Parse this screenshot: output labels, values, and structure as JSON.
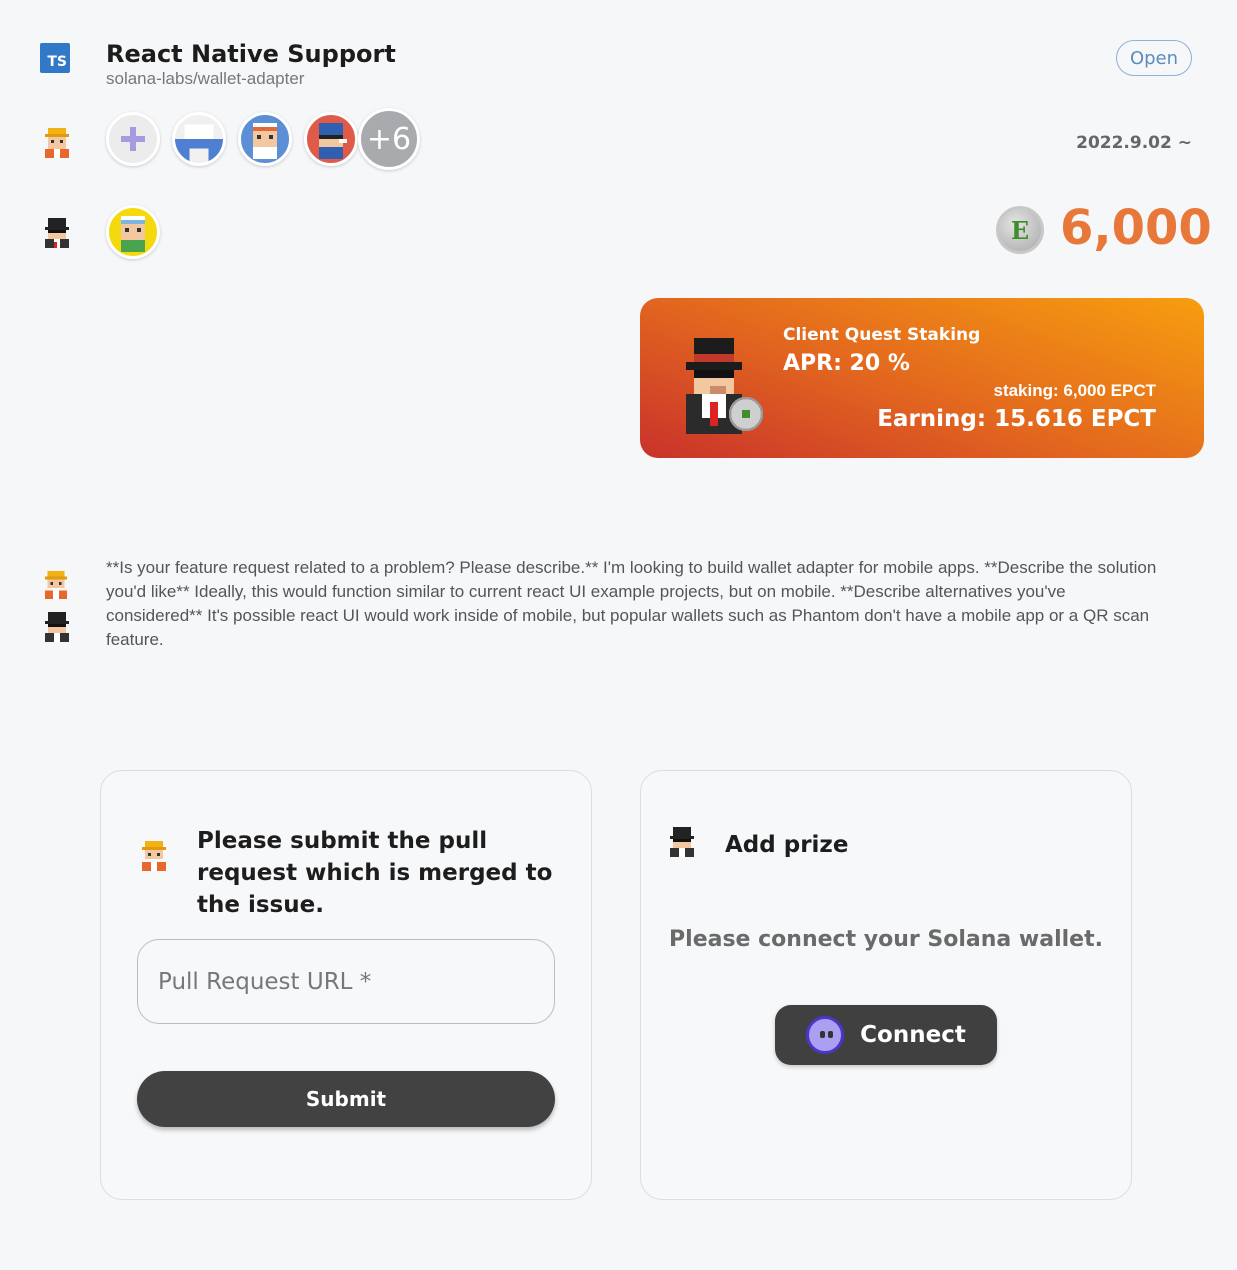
{
  "issue": {
    "language_badge": "TS",
    "title": "React Native Support",
    "repo": "solana-labs/wallet-adapter",
    "status": "Open"
  },
  "participants": {
    "more_count": "+6",
    "date": "2022.9.02 ~"
  },
  "prize": {
    "amount": "6,000",
    "token_letter": "E"
  },
  "staking": {
    "title": "Client Quest Staking",
    "apr": "APR: 20 %",
    "staking": "staking: 6,000 EPCT",
    "earning": "Earning: 15.616 EPCT"
  },
  "description": "**Is your feature request related to a problem? Please describe.** I'm looking to build wallet adapter for mobile apps. **Describe the solution you'd like** Ideally, this would function similar to current react UI example projects, but on mobile. **Describe alternatives you've considered** It's possible react UI would work inside of mobile, but popular wallets such as Phantom don't have a mobile app or a QR scan feature.",
  "submit_card": {
    "heading": "Please submit the pull request which is merged to the issue.",
    "input_placeholder": "Pull Request URL *",
    "submit_label": "Submit"
  },
  "prize_card": {
    "heading": "Add prize",
    "message": "Please connect your Solana wallet.",
    "connect_label": "Connect"
  },
  "colors": {
    "accent_orange": "#e8783a",
    "ts_blue": "#3178c6",
    "open_blue": "#5b8cc0",
    "button_dark": "#424242"
  }
}
